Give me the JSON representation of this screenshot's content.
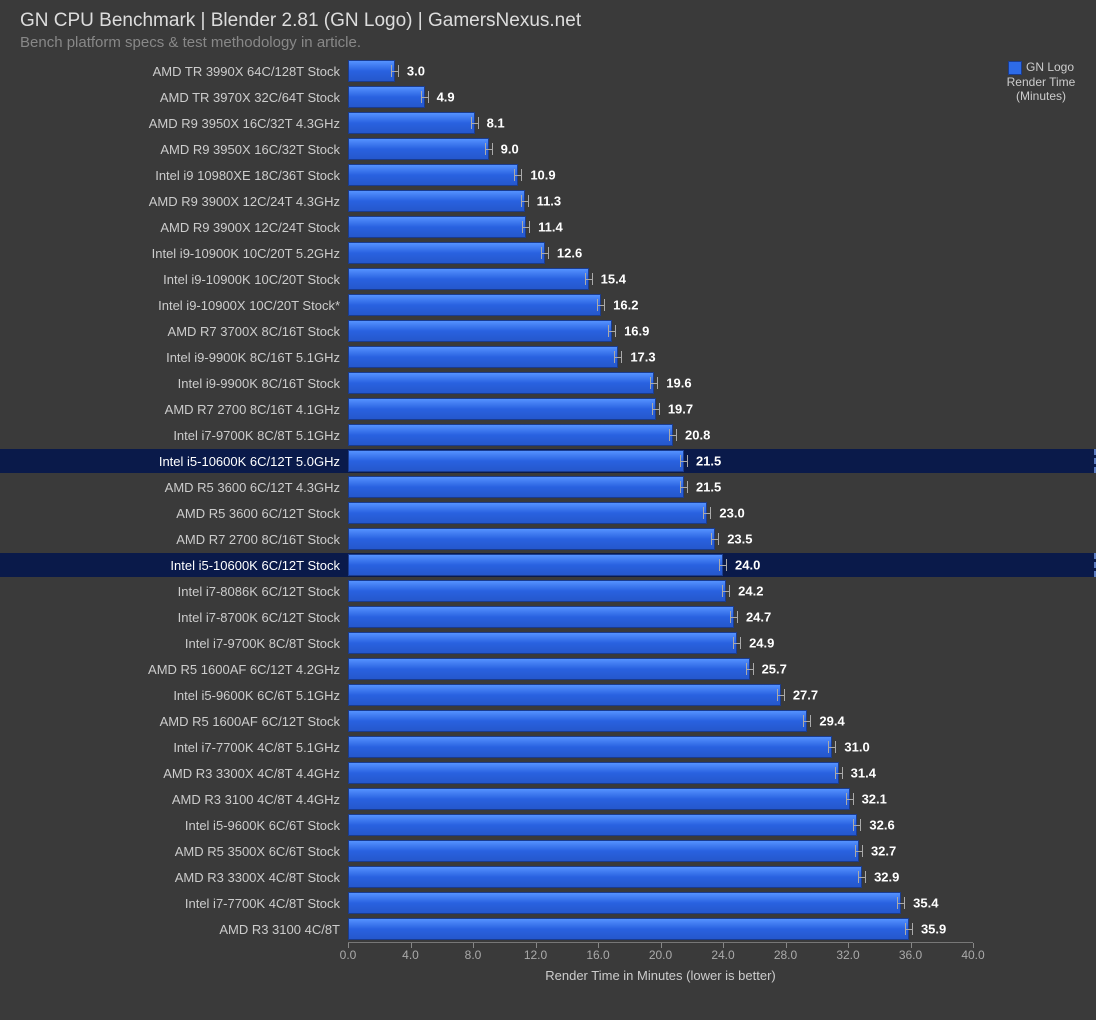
{
  "title": "GN CPU Benchmark | Blender 2.81 (GN Logo) | GamersNexus.net",
  "subtitle": "Bench platform specs & test methodology in article.",
  "legend": {
    "label": "GN Logo Render Time (Minutes)"
  },
  "xlabel": "Render Time in Minutes (lower is better)",
  "chart_data": {
    "type": "bar",
    "xlabel": "Render Time in Minutes (lower is better)",
    "ylabel": "",
    "xlim": [
      0,
      40
    ],
    "ticks": [
      0.0,
      4.0,
      8.0,
      12.0,
      16.0,
      20.0,
      24.0,
      28.0,
      32.0,
      36.0,
      40.0
    ],
    "series_name": "GN Logo Render Time (Minutes)",
    "categories": [
      "AMD TR 3990X 64C/128T Stock",
      "AMD TR 3970X 32C/64T Stock",
      "AMD R9 3950X 16C/32T 4.3GHz",
      "AMD R9 3950X 16C/32T Stock",
      "Intel i9 10980XE 18C/36T Stock",
      "AMD R9 3900X 12C/24T 4.3GHz",
      "AMD R9 3900X 12C/24T Stock",
      "Intel i9-10900K 10C/20T 5.2GHz",
      "Intel i9-10900K 10C/20T Stock",
      "Intel i9-10900X 10C/20T Stock*",
      "AMD R7 3700X 8C/16T Stock",
      "Intel i9-9900K 8C/16T 5.1GHz",
      "Intel i9-9900K 8C/16T Stock",
      "AMD R7 2700 8C/16T 4.1GHz",
      "Intel i7-9700K 8C/8T 5.1GHz",
      "Intel i5-10600K 6C/12T 5.0GHz",
      "AMD R5 3600 6C/12T 4.3GHz",
      "AMD R5 3600 6C/12T Stock",
      "AMD R7 2700 8C/16T Stock",
      "Intel i5-10600K 6C/12T Stock",
      "Intel i7-8086K 6C/12T Stock",
      "Intel i7-8700K 6C/12T Stock",
      "Intel i7-9700K 8C/8T Stock",
      "AMD R5 1600AF 6C/12T 4.2GHz",
      "Intel i5-9600K 6C/6T 5.1GHz",
      "AMD R5 1600AF 6C/12T Stock",
      "Intel i7-7700K 4C/8T 5.1GHz",
      "AMD R3 3300X 4C/8T 4.4GHz",
      "AMD R3 3100 4C/8T 4.4GHz",
      "Intel i5-9600K 6C/6T Stock",
      "AMD R5 3500X 6C/6T Stock",
      "AMD R3 3300X 4C/8T Stock",
      "Intel i7-7700K 4C/8T Stock",
      "AMD R3 3100 4C/8T"
    ],
    "values": [
      3.0,
      4.9,
      8.1,
      9.0,
      10.9,
      11.3,
      11.4,
      12.6,
      15.4,
      16.2,
      16.9,
      17.3,
      19.6,
      19.7,
      20.8,
      21.5,
      21.5,
      23.0,
      23.5,
      24.0,
      24.2,
      24.7,
      24.9,
      25.7,
      27.7,
      29.4,
      31.0,
      31.4,
      32.1,
      32.6,
      32.7,
      32.9,
      35.4,
      35.9
    ],
    "highlight_indices": [
      15,
      19
    ]
  }
}
